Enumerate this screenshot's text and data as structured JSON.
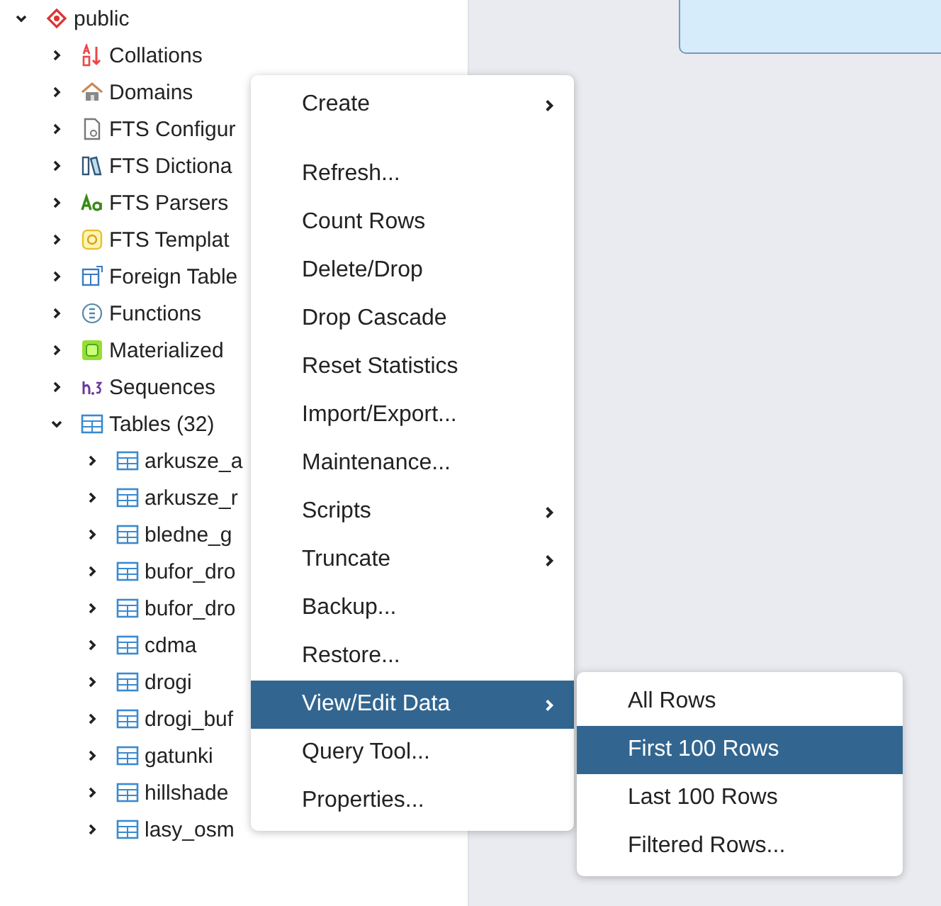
{
  "tree": [
    {
      "label": "public",
      "kind": "schema",
      "expanded": true,
      "children": [
        {
          "label": "Collations",
          "kind": "collation",
          "expanded": false
        },
        {
          "label": "Domains",
          "kind": "domain",
          "expanded": false
        },
        {
          "label": "FTS Configur",
          "kind": "document",
          "expanded": false
        },
        {
          "label": "FTS Dictiona",
          "kind": "dictionary",
          "expanded": false
        },
        {
          "label": "FTS Parsers",
          "kind": "parser",
          "expanded": false
        },
        {
          "label": "FTS Templat",
          "kind": "template",
          "expanded": false
        },
        {
          "label": "Foreign Table",
          "kind": "foreign",
          "expanded": false
        },
        {
          "label": "Functions",
          "kind": "function",
          "expanded": false
        },
        {
          "label": "Materialized",
          "kind": "matview",
          "expanded": false
        },
        {
          "label": "Sequences",
          "kind": "sequence",
          "expanded": false
        },
        {
          "label": "Tables (32)",
          "kind": "table",
          "expanded": true,
          "children": [
            {
              "label": "arkusze_a",
              "kind": "table",
              "expanded": false
            },
            {
              "label": "arkusze_r",
              "kind": "table",
              "expanded": false
            },
            {
              "label": "bledne_g",
              "kind": "table",
              "expanded": false
            },
            {
              "label": "bufor_dro",
              "kind": "table",
              "expanded": false
            },
            {
              "label": "bufor_dro",
              "kind": "table",
              "expanded": false
            },
            {
              "label": "cdma",
              "kind": "table",
              "expanded": false
            },
            {
              "label": "drogi",
              "kind": "table",
              "expanded": false
            },
            {
              "label": "drogi_buf",
              "kind": "table",
              "expanded": false
            },
            {
              "label": "gatunki",
              "kind": "table",
              "expanded": false
            },
            {
              "label": "hillshade",
              "kind": "table",
              "expanded": false
            },
            {
              "label": "lasy_osm",
              "kind": "table",
              "expanded": false
            }
          ]
        }
      ]
    }
  ],
  "context_menu": {
    "groups": [
      [
        {
          "label": "Create",
          "submenu": true,
          "selected": false
        }
      ],
      [
        {
          "label": "Refresh...",
          "submenu": false,
          "selected": false
        },
        {
          "label": "Count Rows",
          "submenu": false,
          "selected": false
        },
        {
          "label": "Delete/Drop",
          "submenu": false,
          "selected": false
        },
        {
          "label": "Drop Cascade",
          "submenu": false,
          "selected": false
        },
        {
          "label": "Reset Statistics",
          "submenu": false,
          "selected": false
        },
        {
          "label": "Import/Export...",
          "submenu": false,
          "selected": false
        },
        {
          "label": "Maintenance...",
          "submenu": false,
          "selected": false
        },
        {
          "label": "Scripts",
          "submenu": true,
          "selected": false
        },
        {
          "label": "Truncate",
          "submenu": true,
          "selected": false
        },
        {
          "label": "Backup...",
          "submenu": false,
          "selected": false
        },
        {
          "label": "Restore...",
          "submenu": false,
          "selected": false
        },
        {
          "label": "View/Edit Data",
          "submenu": true,
          "selected": true
        },
        {
          "label": "Query Tool...",
          "submenu": false,
          "selected": false
        },
        {
          "label": "Properties...",
          "submenu": false,
          "selected": false
        }
      ]
    ]
  },
  "submenu": {
    "items": [
      {
        "label": "All Rows",
        "selected": false
      },
      {
        "label": "First 100 Rows",
        "selected": true
      },
      {
        "label": "Last 100 Rows",
        "selected": false
      },
      {
        "label": "Filtered Rows...",
        "selected": false
      }
    ]
  }
}
